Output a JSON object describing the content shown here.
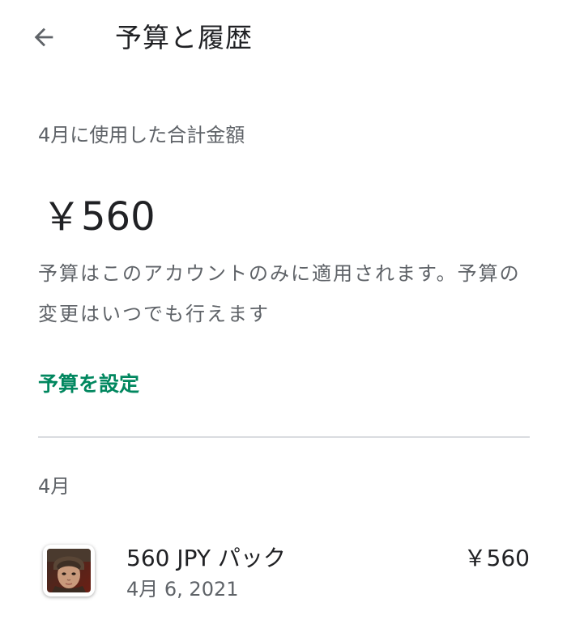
{
  "header": {
    "title": "予算と履歴",
    "back_icon": "arrow-left-icon"
  },
  "summary": {
    "label": "4月に使用した合計金額",
    "total": "￥560",
    "note": "予算はこのアカウントのみに適用されます。予算の変更はいつでも行えます",
    "set_budget_label": "予算を設定"
  },
  "history": {
    "month": "4月",
    "items": [
      {
        "name": "560 JPY パック",
        "date": "4月 6, 2021",
        "price": "￥560",
        "icon": "game-character-portrait-icon"
      }
    ]
  },
  "colors": {
    "accent": "#01875f",
    "text_primary": "#202124",
    "text_secondary": "#5f6368",
    "divider": "#dadce0"
  }
}
